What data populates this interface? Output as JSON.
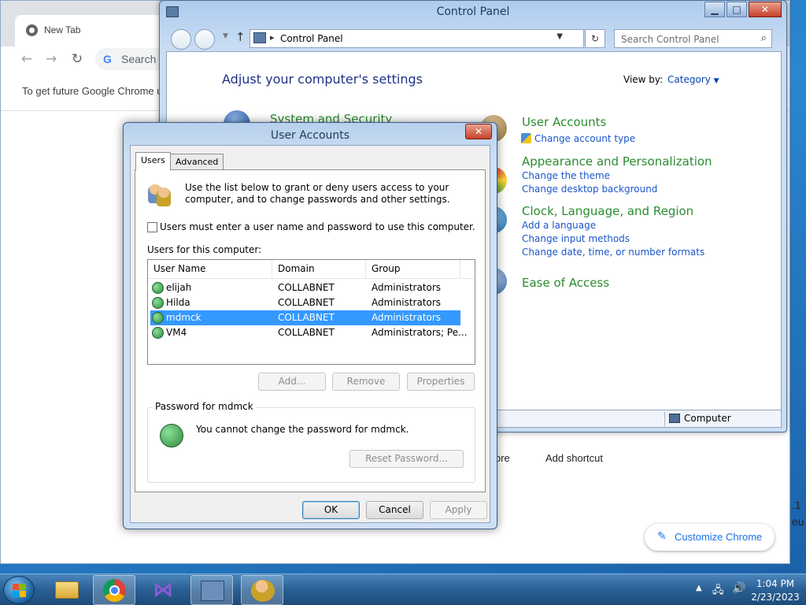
{
  "chrome": {
    "tab_title": "New Tab",
    "omnibox_text": "Search G",
    "infobar_text": "To get future Google Chrome u",
    "customize_label": "Customize Chrome",
    "shortcut_partial": "ore",
    "add_shortcut": "Add shortcut",
    "edge_line1": ".1",
    "edge_line2": "eu"
  },
  "control_panel": {
    "title": "Control Panel",
    "address": "Control Panel",
    "search_placeholder": "Search Control Panel",
    "heading": "Adjust your computer's settings",
    "view_by_label": "View by:",
    "view_by_value": "Category",
    "categories": [
      {
        "title": "System and Security",
        "links": []
      },
      {
        "title": "User Accounts",
        "links": [
          "Change account type"
        ]
      },
      {
        "title": "Appearance and Personalization",
        "links": [
          "Change the theme",
          "Change desktop background"
        ]
      },
      {
        "title": "Clock, Language, and Region",
        "links": [
          "Add a language",
          "Change input methods",
          "Change date, time, or number formats"
        ]
      },
      {
        "title": "Ease of Access",
        "links": []
      }
    ],
    "status_text": "Computer"
  },
  "user_accounts": {
    "title": "User Accounts",
    "tabs": [
      "Users",
      "Advanced"
    ],
    "intro": "Use the list below to grant or deny users access to your computer, and to change passwords and other settings.",
    "checkbox_label": "Users must enter a user name and password to use this computer.",
    "list_label": "Users for this computer:",
    "columns": [
      "User Name",
      "Domain",
      "Group"
    ],
    "rows": [
      {
        "name": "elijah",
        "domain": "COLLABNET",
        "group": "Administrators"
      },
      {
        "name": "Hilda",
        "domain": "COLLABNET",
        "group": "Administrators"
      },
      {
        "name": "mdmck",
        "domain": "COLLABNET",
        "group": "Administrators"
      },
      {
        "name": "VM4",
        "domain": "COLLABNET",
        "group": "Administrators; Pe..."
      }
    ],
    "selected_row": 2,
    "buttons": {
      "add": "Add...",
      "remove": "Remove",
      "properties": "Properties"
    },
    "password_group_title": "Password for mdmck",
    "password_text": "You cannot change the password for mdmck.",
    "reset_password": "Reset Password...",
    "ok": "OK",
    "cancel": "Cancel",
    "apply": "Apply"
  },
  "taskbar": {
    "time": "1:04 PM",
    "date": "2/23/2023",
    "tray_expand": "▲"
  },
  "colors": {
    "selection": "#3399ff",
    "link": "#1a56c9",
    "category_title": "#2b8c2f",
    "heading": "#1e3287"
  }
}
